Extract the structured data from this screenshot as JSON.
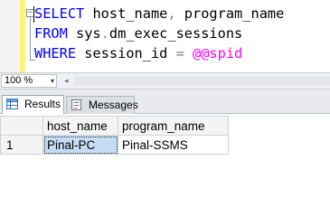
{
  "editor": {
    "fold_marker": "−",
    "lines": [
      {
        "k1": "SELECT",
        "t1": " host_name",
        "g1": ",",
        "t2": " program_name"
      },
      {
        "k1": "FROM",
        "t1": " sys",
        "g1": ".",
        "t2": "dm_exec_sessions"
      },
      {
        "k1": "WHERE",
        "t1": " session_id ",
        "g1": "=",
        "f1": " @@spid"
      }
    ]
  },
  "zoom": {
    "value": "100 %",
    "arrow": "▾",
    "scroll_left": "◂"
  },
  "tabs": [
    {
      "label": "Results",
      "icon": "results-grid-icon",
      "active": true
    },
    {
      "label": "Messages",
      "icon": "messages-icon",
      "active": false
    }
  ],
  "results": {
    "columns": [
      "host_name",
      "program_name"
    ],
    "rows": [
      {
        "num": "1",
        "cells": [
          "Pinal-PC",
          "Pinal-SSMS"
        ]
      }
    ]
  },
  "colors": {
    "keyword": "#0000ff",
    "operator": "#808080",
    "system_function": "#ff00ff",
    "change_bar": "#fff17a",
    "selected_cell": "#c6dcf4"
  }
}
